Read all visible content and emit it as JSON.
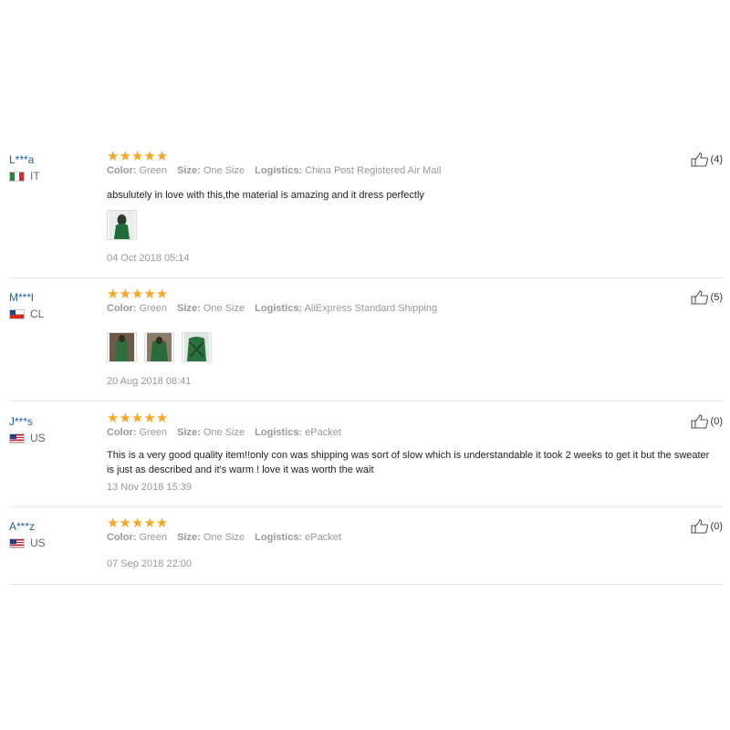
{
  "reviews": [
    {
      "user": "L***a",
      "country": "IT",
      "flag": "flag-italy",
      "rating": 5,
      "stars": "★★★★★",
      "color_label": "Color:",
      "color": "Green",
      "size_label": "Size:",
      "size": "One Size",
      "logistics_label": "Logistics:",
      "logistics": "China Post Registered Air Mail",
      "text": "absulutely in love with this,the material is amazing and it dress perfectly",
      "images": [
        "photo-thumbnail"
      ],
      "date": "04 Oct 2018 05:14",
      "helpful": "(4)"
    },
    {
      "user": "M***l",
      "country": "CL",
      "flag": "flag-chile",
      "rating": 5,
      "stars": "★★★★★",
      "color_label": "Color:",
      "color": "Green",
      "size_label": "Size:",
      "size": "One Size",
      "logistics_label": "Logistics:",
      "logistics": "AliExpress Standard Shipping",
      "text": "",
      "images": [
        "photo-thumbnail",
        "photo-thumbnail",
        "photo-thumbnail"
      ],
      "date": "20 Aug 2018 08:41",
      "helpful": "(5)"
    },
    {
      "user": "J***s",
      "country": "US",
      "flag": "flag-usa",
      "rating": 5,
      "stars": "★★★★★",
      "color_label": "Color:",
      "color": "Green",
      "size_label": "Size:",
      "size": "One Size",
      "logistics_label": "Logistics:",
      "logistics": "ePacket",
      "text": "This is a very good quality item!!only con was shipping was sort of slow which is understandable it took 2 weeks to get it but the sweater is just as described and it's warm ! love it was worth the wait",
      "images": [],
      "date": "13 Nov 2018 15:39",
      "helpful": "(0)"
    },
    {
      "user": "A***z",
      "country": "US",
      "flag": "flag-usa",
      "rating": 5,
      "stars": "★★★★★",
      "color_label": "Color:",
      "color": "Green",
      "size_label": "Size:",
      "size": "One Size",
      "logistics_label": "Logistics:",
      "logistics": "ePacket",
      "text": "",
      "images": [],
      "date": "07 Sep 2018 22:00",
      "helpful": "(0)"
    }
  ],
  "colors": {
    "star": "#f5a623",
    "username": "#1f5fa8",
    "muted": "#999999",
    "divider": "#e8e8e8"
  }
}
